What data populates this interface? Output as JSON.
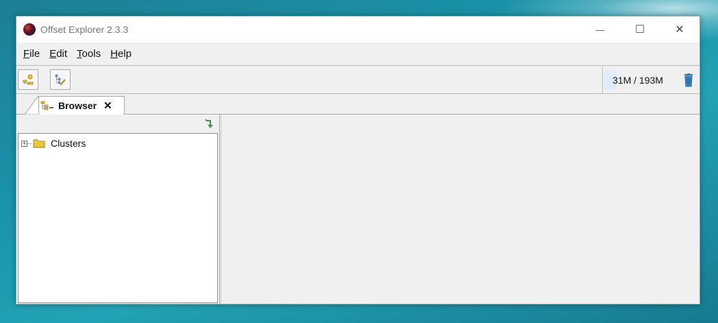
{
  "window": {
    "title": "Offset Explorer  2.3.3",
    "controls": {
      "minimize": "—",
      "maximize": "☐",
      "close": "✕"
    }
  },
  "menu": [
    {
      "label": "ile",
      "mnemonic": "F"
    },
    {
      "label": "dit",
      "mnemonic": "E"
    },
    {
      "label": "ools",
      "mnemonic": "T"
    },
    {
      "label": "elp",
      "mnemonic": "H"
    }
  ],
  "toolbar": {
    "add_cluster_icon": "add-cluster-icon",
    "edit_tree_icon": "edit-tree-icon",
    "memory": "31M / 193M",
    "memory_usage_fraction": 0.16,
    "gc_icon": "trash-icon"
  },
  "tabs": [
    {
      "label": "Browser",
      "close": "✕",
      "icon": "browser-tree-icon"
    }
  ],
  "browser": {
    "refresh_icon": "refresh-arrow-icon",
    "tree": [
      {
        "label": "Clusters",
        "expander": "+",
        "icon": "folder-icon"
      }
    ]
  },
  "colors": {
    "accent_green": "#3c9a3c",
    "folder_yellow": "#e8c53a",
    "trash_blue": "#2f7fb7"
  }
}
